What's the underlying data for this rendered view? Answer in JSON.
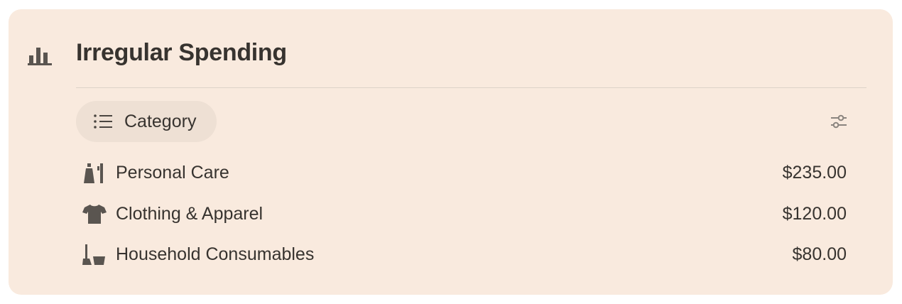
{
  "widget": {
    "title": "Irregular Spending",
    "header_icon": "bar-chart-icon"
  },
  "view_selector": {
    "label": "Category",
    "icon": "list-icon"
  },
  "filter": {
    "icon": "sliders-icon"
  },
  "categories": [
    {
      "name": "Personal Care",
      "amount": "$235.00",
      "icon": "personal-care-icon"
    },
    {
      "name": "Clothing & Apparel",
      "amount": "$120.00",
      "icon": "tshirt-icon"
    },
    {
      "name": "Household Consumables",
      "amount": "$80.00",
      "icon": "broom-bucket-icon"
    }
  ],
  "colors": {
    "card_background": "#f9eade",
    "pill_background": "#eee0d4",
    "text": "#37332f",
    "icon": "#5a5550"
  }
}
